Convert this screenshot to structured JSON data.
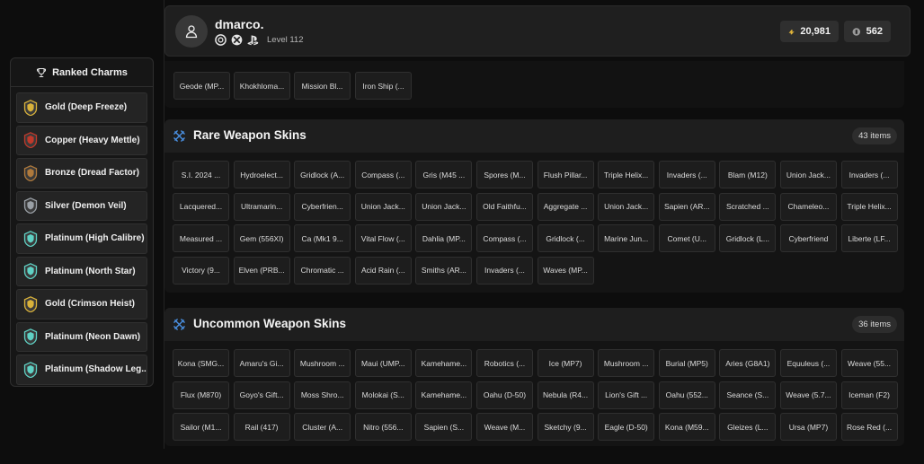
{
  "sidebar": {
    "title": "Ranked Charms",
    "title_icon": "trophy-icon",
    "items": [
      {
        "label": "Gold (Deep Freeze)",
        "tier": "gold"
      },
      {
        "label": "Copper (Heavy Mettle)",
        "tier": "copper"
      },
      {
        "label": "Bronze (Dread Factor)",
        "tier": "bronze"
      },
      {
        "label": "Silver (Demon Veil)",
        "tier": "silver"
      },
      {
        "label": "Platinum (High Calibre)",
        "tier": "platinum"
      },
      {
        "label": "Platinum (North Star)",
        "tier": "platinum"
      },
      {
        "label": "Gold (Crimson Heist)",
        "tier": "gold"
      },
      {
        "label": "Platinum (Neon Dawn)",
        "tier": "platinum"
      },
      {
        "label": "Platinum (Shadow Leg...",
        "tier": "platinum"
      }
    ]
  },
  "profile": {
    "username": "dmarco.",
    "level": "Level 112",
    "platforms": [
      "ubisoft-icon",
      "xbox-icon",
      "playstation-icon"
    ],
    "credits": "20,981",
    "renown": "562"
  },
  "epic_partial": [
    "Geode (MP...",
    "Khokhloma...",
    "Mission Bl...",
    "Iron Ship (..."
  ],
  "rare": {
    "title": "Rare Weapon Skins",
    "count": "43 items",
    "items": [
      "S.I. 2024 ...",
      "Hydroelect...",
      "Gridlock (A...",
      "Compass (...",
      "Gris (M45 ...",
      "Spores (M...",
      "Flush Pillar...",
      "Triple Helix...",
      "Invaders (...",
      "Blam (M12)",
      "Union Jack...",
      "Invaders (...",
      "Lacquered...",
      "Ultramarin...",
      "Cyberfrien...",
      "Union Jack...",
      "Union Jack...",
      "Old Faithfu...",
      "Aggregate ...",
      "Union Jack...",
      "Sapien (AR...",
      "Scratched ...",
      "Chameleo...",
      "Triple Helix...",
      "Measured ...",
      "Gem (556XI)",
      "Ca (Mk1 9...",
      "Vital Flow (...",
      "Dahlia (MP...",
      "Compass (...",
      "Gridlock (...",
      "Marine Jun...",
      "Comet (U...",
      "Gridlock (L...",
      "Cyberfriend",
      "Liberte (LF...",
      "Victory (9...",
      "Elven (PRB...",
      "Chromatic ...",
      "Acid Rain (...",
      "Smiths (AR...",
      "Invaders (...",
      "Waves (MP..."
    ]
  },
  "uncommon": {
    "title": "Uncommon Weapon Skins",
    "count": "36 items",
    "items": [
      "Kona (SMG...",
      "Amaru's Gi...",
      "Mushroom ...",
      "Maui (UMP...",
      "Kamehame...",
      "Robotics (...",
      "Ice (MP7)",
      "Mushroom ...",
      "Burial (MP5)",
      "Aries (G8A1)",
      "Equuleus (...",
      "Weave (55...",
      "Flux (M870)",
      "Goyo's Gift...",
      "Moss Shro...",
      "Molokai (S...",
      "Kamehame...",
      "Oahu (D-50)",
      "Nebula (R4...",
      "Lion's Gift ...",
      "Oahu (552...",
      "Seance (S...",
      "Weave (5.7...",
      "Iceman (F2)",
      "Sailor (M1...",
      "Rail (417)",
      "Cluster (A...",
      "Nitro (556...",
      "Sapien (S...",
      "Weave (M...",
      "Sketchy (9...",
      "Eagle (D-50)",
      "Kona (M59...",
      "Gleizes (L...",
      "Ursa (MP7)",
      "Rose Red (..."
    ]
  },
  "colors": {
    "gold": "#d9b23a",
    "copper": "#c0392b",
    "bronze": "#b07a3c",
    "silver": "#9aa0a6",
    "platinum": "#5fd1c4",
    "accent_blue": "#4a90e2"
  }
}
